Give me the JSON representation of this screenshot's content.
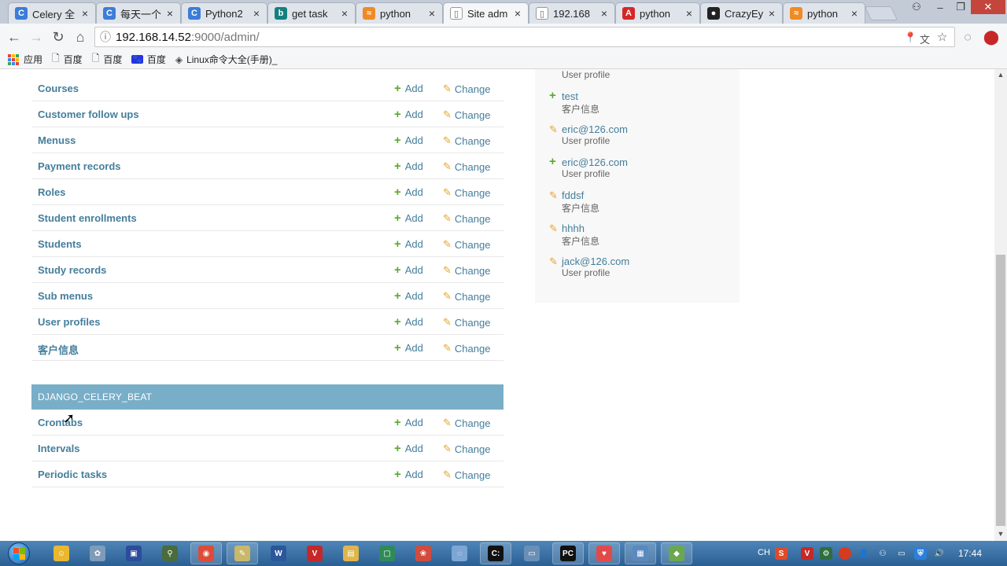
{
  "tabs": [
    {
      "title": "Celery 全",
      "favicon": "celery-icon",
      "color": "#3b7dd8",
      "glyph": "C"
    },
    {
      "title": "每天一个",
      "favicon": "celery-icon",
      "color": "#3b7dd8",
      "glyph": "C"
    },
    {
      "title": "Python2",
      "favicon": "celery-icon",
      "color": "#3b7dd8",
      "glyph": "C"
    },
    {
      "title": "get task",
      "favicon": "bing-icon",
      "color": "#138080",
      "glyph": "b"
    },
    {
      "title": "python",
      "favicon": "csdn-icon",
      "color": "#f08a24",
      "glyph": "≈"
    },
    {
      "title": "Site adm",
      "favicon": "page-icon",
      "color": "#ffffff",
      "glyph": "▯"
    },
    {
      "title": "192.168",
      "favicon": "page-icon",
      "color": "#ffffff",
      "glyph": "▯"
    },
    {
      "title": "python",
      "favicon": "angular-icon",
      "color": "#d62728",
      "glyph": "A"
    },
    {
      "title": "CrazyEy",
      "favicon": "github-icon",
      "color": "#222222",
      "glyph": "●"
    },
    {
      "title": "python",
      "favicon": "csdn-icon",
      "color": "#f08a24",
      "glyph": "≈"
    }
  ],
  "address": {
    "host": "192.168.14.52",
    "path": ":9000/admin/"
  },
  "bookmarks": [
    {
      "label": "应用",
      "icon": "apps-grid-icon"
    },
    {
      "label": "百度",
      "icon": "page-icon"
    },
    {
      "label": "百度",
      "icon": "page-icon"
    },
    {
      "label": "百度",
      "icon": "baidu-paw-icon"
    },
    {
      "label": "Linux命令大全(手册)_",
      "icon": "diamond-icon"
    }
  ],
  "actions": {
    "add": "Add",
    "change": "Change"
  },
  "crm_models": [
    "Courses",
    "Customer follow ups",
    "Menuss",
    "Payment records",
    "Roles",
    "Student enrollments",
    "Students",
    "Study records",
    "Sub menus",
    "User profiles",
    "客户信息"
  ],
  "celery": {
    "header": "DJANGO_CELERY_BEAT",
    "models": [
      "Crontabs",
      "Intervals",
      "Periodic tasks"
    ]
  },
  "recent_actions": {
    "top_partial_type": "User profile",
    "items": [
      {
        "kind": "add",
        "object": "test",
        "type": "客户信息"
      },
      {
        "kind": "change",
        "object": "eric@126.com",
        "type": "User profile"
      },
      {
        "kind": "add",
        "object": "eric@126.com",
        "type": "User profile"
      },
      {
        "kind": "change",
        "object": "fddsf",
        "type": "客户信息"
      },
      {
        "kind": "change",
        "object": "hhhh",
        "type": "客户信息"
      },
      {
        "kind": "change",
        "object": "jack@126.com",
        "type": "User profile"
      }
    ]
  },
  "taskbar": {
    "apps": [
      {
        "name": "browser-app",
        "color": "#e9b730",
        "glyph": "☺"
      },
      {
        "name": "tool-app",
        "color": "#7f9bb8",
        "glyph": "✿"
      },
      {
        "name": "save-app",
        "color": "#2c4c9c",
        "glyph": "▣"
      },
      {
        "name": "tree-app",
        "color": "#4a6b3c",
        "glyph": "⚲"
      },
      {
        "name": "chrome-app",
        "color": "#dd4b39",
        "glyph": "◉"
      },
      {
        "name": "notepad-app",
        "color": "#c9b86a",
        "glyph": "✎"
      },
      {
        "name": "word-app",
        "color": "#2b579a",
        "glyph": "W"
      },
      {
        "name": "wps-app",
        "color": "#c62828",
        "glyph": "V"
      },
      {
        "name": "folder-app",
        "color": "#e0b54a",
        "glyph": "▤"
      },
      {
        "name": "box-app",
        "color": "#2e8b57",
        "glyph": "▢"
      },
      {
        "name": "game-app",
        "color": "#d24b3f",
        "glyph": "❀"
      },
      {
        "name": "paint-app",
        "color": "#7ea6d4",
        "glyph": "◌"
      },
      {
        "name": "terminal-app",
        "color": "#111111",
        "glyph": "C:"
      },
      {
        "name": "window-app",
        "color": "#6a8fb5",
        "glyph": "▭"
      },
      {
        "name": "pycharm-app",
        "color": "#111111",
        "glyph": "PC"
      },
      {
        "name": "heart-app",
        "color": "#e24a4a",
        "glyph": "♥"
      },
      {
        "name": "remote-app",
        "color": "#5a88c0",
        "glyph": "▦"
      },
      {
        "name": "green-app",
        "color": "#6aa84f",
        "glyph": "◆"
      }
    ],
    "ime": "CH",
    "clock": "17:44"
  }
}
